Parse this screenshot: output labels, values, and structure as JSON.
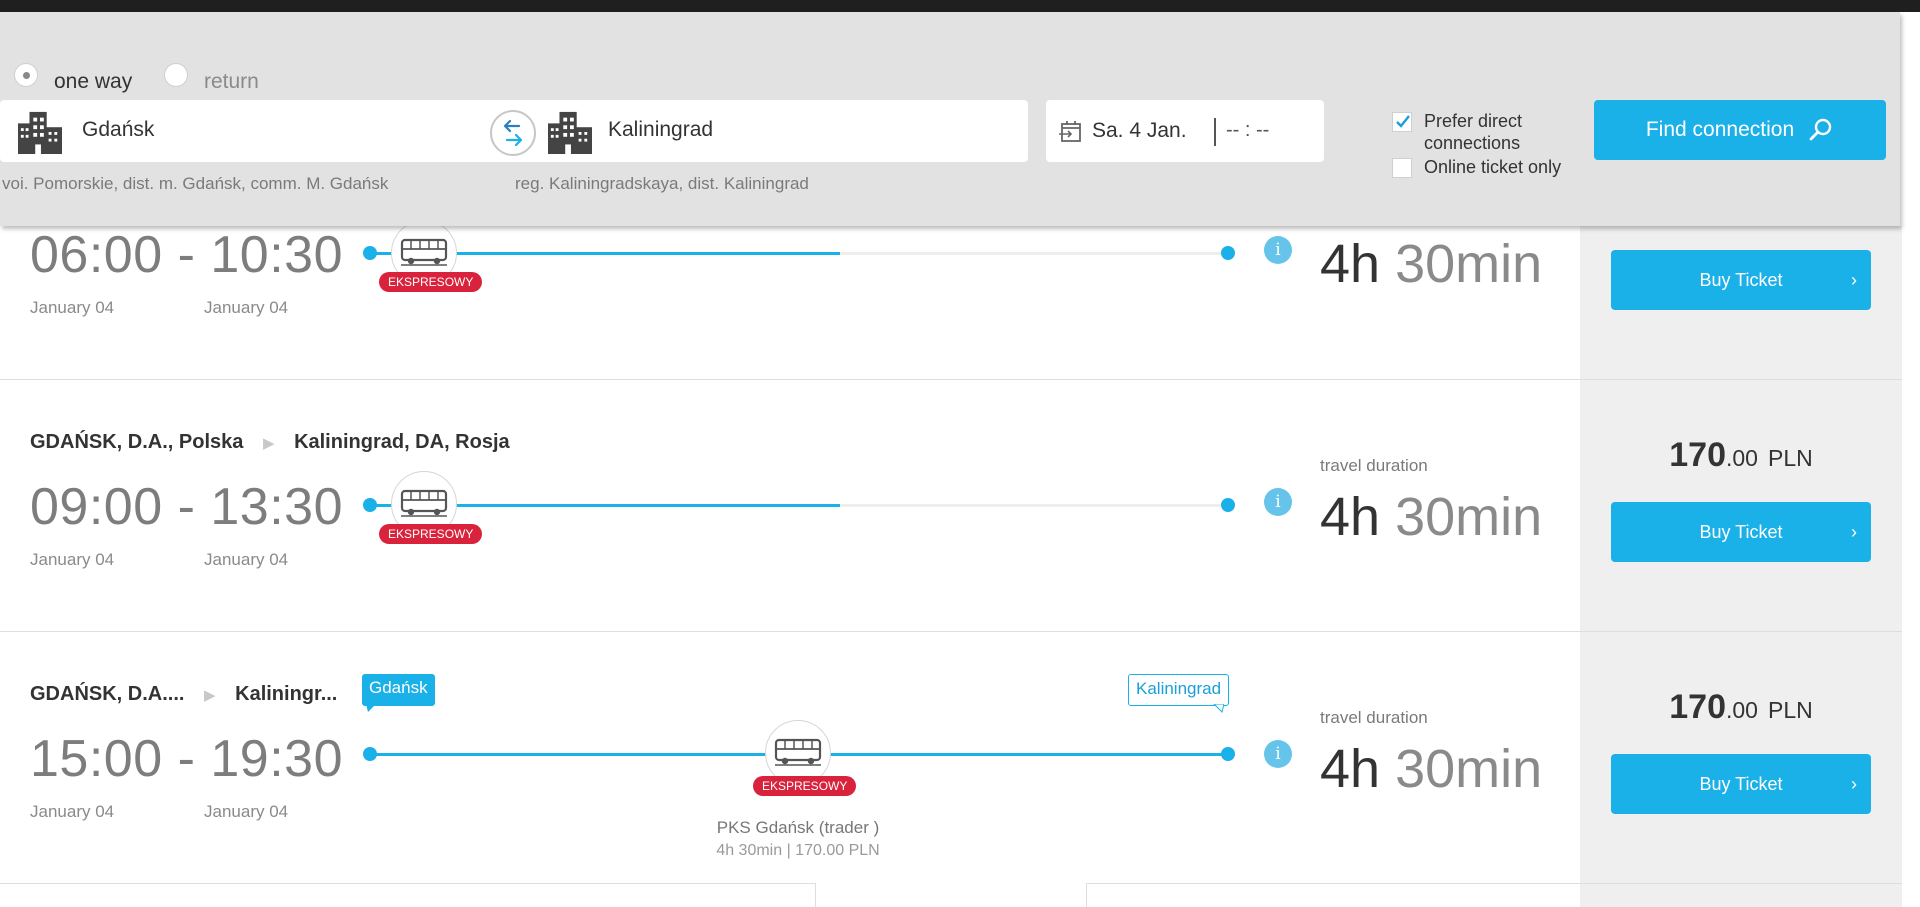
{
  "search": {
    "trip_type": [
      {
        "label": "one way",
        "selected": true
      },
      {
        "label": "return",
        "selected": false
      }
    ],
    "from": {
      "city": "Gdańsk",
      "region": "voi. Pomorskie, dist. m. Gdańsk, comm. M. Gdańsk"
    },
    "to": {
      "city": "Kaliningrad",
      "region": "reg. Kaliningradskaya, dist. Kaliningrad"
    },
    "date": "Sa. 4 Jan.",
    "time_placeholder": "-- : --",
    "options": [
      {
        "label": "Prefer direct connections",
        "checked": true
      },
      {
        "label": "Online ticket only",
        "checked": false
      }
    ],
    "find_button": "Find connection"
  },
  "results": [
    {
      "depart": "06:00",
      "arrive": "10:30",
      "depart_date": "January 04",
      "arrive_date": "January 04",
      "badge": "EKSPRESOWY",
      "duration_hours": "4h",
      "duration_minutes": "30min",
      "buy_label": "Buy Ticket"
    },
    {
      "route_from": "GDAŃSK, D.A., Polska",
      "route_to": "Kaliningrad, DA, Rosja",
      "depart": "09:00",
      "arrive": "13:30",
      "depart_date": "January 04",
      "arrive_date": "January 04",
      "badge": "EKSPRESOWY",
      "duration_label": "travel duration",
      "duration_hours": "4h",
      "duration_minutes": "30min",
      "price_int": "170",
      "price_dec": ".00",
      "currency": "PLN",
      "buy_label": "Buy Ticket"
    },
    {
      "route_from": "GDAŃSK, D.A....",
      "route_to": "Kaliningr...",
      "tag_from": "Gdańsk",
      "tag_to": "Kaliningrad",
      "depart": "15:00",
      "arrive": "19:30",
      "depart_date": "January 04",
      "arrive_date": "January 04",
      "badge": "EKSPRESOWY",
      "operator": "PKS Gdańsk (trader )",
      "operator_summary": "4h 30min | 170.00  PLN",
      "duration_label": "travel duration",
      "duration_hours": "4h",
      "duration_minutes": "30min",
      "price_int": "170",
      "price_dec": ".00",
      "currency": "PLN",
      "buy_label": "Buy Ticket"
    }
  ],
  "colors": {
    "accent": "#1ab0e8",
    "badge": "#d9233c",
    "header_bg": "#e2e2e2",
    "topbar": "#1f1f1f"
  }
}
